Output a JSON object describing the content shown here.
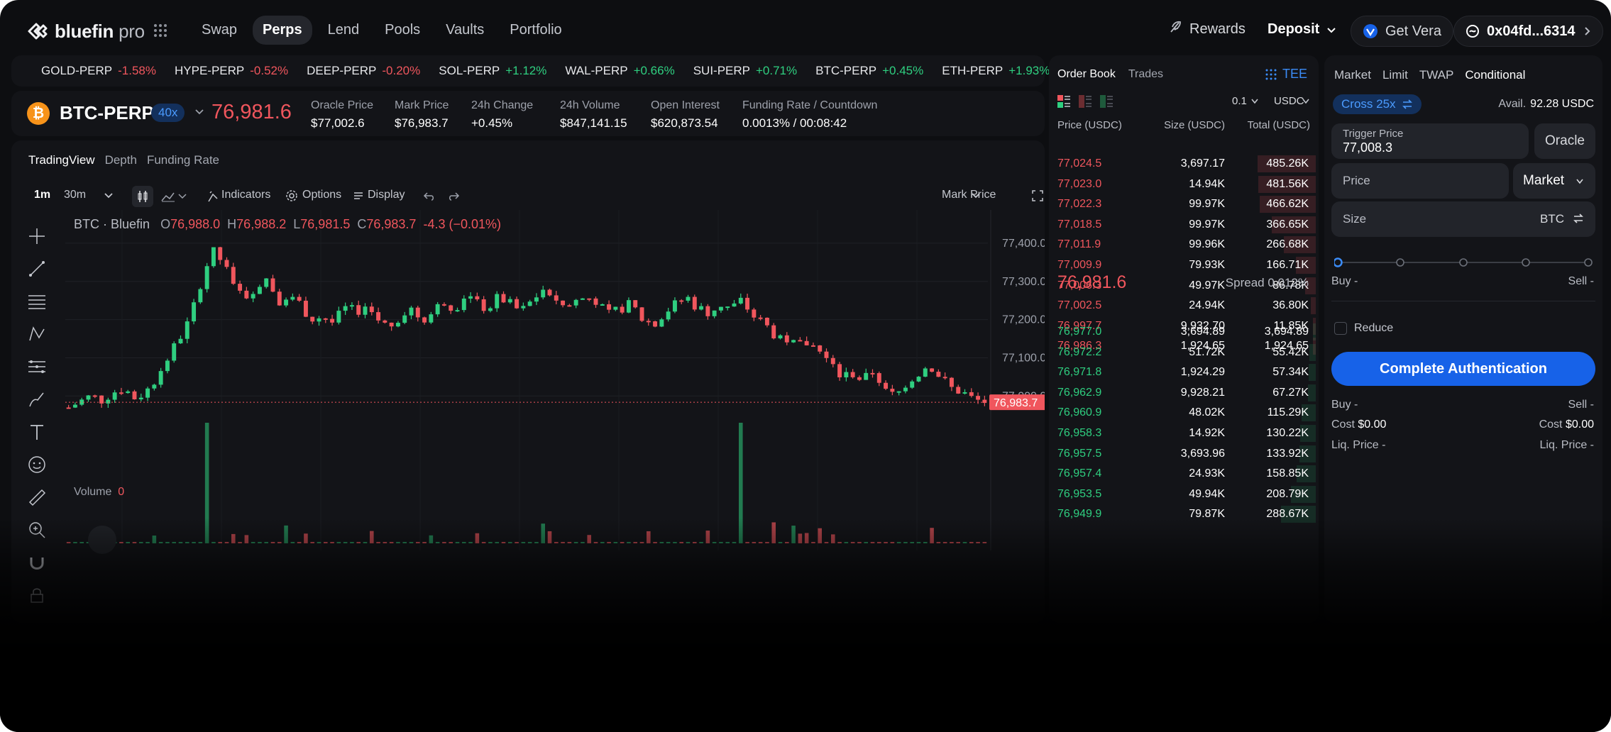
{
  "brand": {
    "name": "bluefin",
    "suffix": "pro"
  },
  "nav": {
    "items": [
      {
        "label": "Swap",
        "active": false
      },
      {
        "label": "Perps",
        "active": true
      },
      {
        "label": "Lend",
        "active": false
      },
      {
        "label": "Pools",
        "active": false
      },
      {
        "label": "Vaults",
        "active": false
      },
      {
        "label": "Portfolio",
        "active": false
      }
    ]
  },
  "header": {
    "rewards": "Rewards",
    "deposit": "Deposit",
    "get_vera": "Get Vera",
    "wallet": "0x04fd...6314"
  },
  "ticker": [
    {
      "symbol": "GOLD-PERP",
      "change": "-1.58%",
      "dir": "down"
    },
    {
      "symbol": "HYPE-PERP",
      "change": "-0.52%",
      "dir": "down"
    },
    {
      "symbol": "DEEP-PERP",
      "change": "-0.20%",
      "dir": "down"
    },
    {
      "symbol": "SOL-PERP",
      "change": "+1.12%",
      "dir": "up"
    },
    {
      "symbol": "WAL-PERP",
      "change": "+0.66%",
      "dir": "up"
    },
    {
      "symbol": "SUI-PERP",
      "change": "+0.71%",
      "dir": "up"
    },
    {
      "symbol": "BTC-PERP",
      "change": "+0.45%",
      "dir": "up"
    },
    {
      "symbol": "ETH-PERP",
      "change": "+1.93%",
      "dir": "up"
    }
  ],
  "market": {
    "coin_glyph": "₿",
    "pair": "BTC-PERP",
    "leverage": "40x",
    "price": "76,981.6",
    "oracle_label": "Oracle Price",
    "oracle": "$77,002.6",
    "mark_label": "Mark Price",
    "mark": "$76,983.7",
    "change_label": "24h Change",
    "change": "+0.45%",
    "volume_label": "24h Volume",
    "volume": "$847,141.15",
    "oi_label": "Open Interest",
    "oi": "$620,873.54",
    "funding_label": "Funding Rate / Countdown",
    "funding": "0.0013%",
    "countdown": "/ 00:08:42"
  },
  "chart_tabs": [
    "TradingView",
    "Depth",
    "Funding Rate"
  ],
  "chart_toolbar": {
    "interval1": "1m",
    "interval2": "30m",
    "indicators": "Indicators",
    "options": "Options",
    "display": "Display",
    "price_type": "Mark Price"
  },
  "chart_legend": {
    "title": "BTC · Bluefin",
    "o_label": "O",
    "o": "76,988.0",
    "h_label": "H",
    "h": "76,988.2",
    "l_label": "L",
    "l": "76,981.5",
    "c_label": "C",
    "c": "76,983.7",
    "chg": "-4.3 (−0.01%)",
    "volume_label": "Volume",
    "volume": "0",
    "last_price_tag": "76,983.7"
  },
  "chart_data": {
    "type": "candlestick",
    "title": "BTC · Bluefin",
    "y_ticks": [
      "77,400.0",
      "77,300.0",
      "77,200.0",
      "77,100.0",
      "77,000.0"
    ],
    "ylim": [
      76930,
      77450
    ],
    "close_path": [
      76970,
      76985,
      77000,
      76990,
      77010,
      77020,
      76995,
      77010,
      77050,
      77100,
      77150,
      77200,
      77300,
      77380,
      77350,
      77280,
      77260,
      77290,
      77310,
      77250,
      77270,
      77240,
      77200,
      77210,
      77190,
      77230,
      77220,
      77240,
      77200,
      77180,
      77210,
      77230,
      77200,
      77220,
      77250,
      77230,
      77270,
      77240,
      77230,
      77260,
      77240,
      77220,
      77250,
      77280,
      77260,
      77230,
      77250,
      77260,
      77240,
      77210,
      77230,
      77240,
      77200,
      77190,
      77220,
      77240,
      77260,
      77230,
      77220,
      77240,
      77230,
      77250,
      77210,
      77190,
      77160,
      77150,
      77130,
      77140,
      77120,
      77080,
      77050,
      77060,
      77040,
      77070,
      77010,
      77000,
      77040,
      77060,
      77080,
      77050,
      77020,
      77010,
      76990,
      76985
    ],
    "last": 76983.7
  },
  "orderbook": {
    "tab_orderbook": "Order Book",
    "tab_trades": "Trades",
    "tee": "TEE",
    "tick": "0.1",
    "unit": "USDC",
    "col_price": "Price (USDC)",
    "col_size": "Size (USDC)",
    "col_total": "Total (USDC)",
    "asks": [
      {
        "price": "77,024.5",
        "size": "3,697.17",
        "total": "485.26K",
        "depth": 1.0
      },
      {
        "price": "77,023.0",
        "size": "14.94K",
        "total": "481.56K",
        "depth": 0.99
      },
      {
        "price": "77,022.3",
        "size": "99.97K",
        "total": "466.62K",
        "depth": 0.96
      },
      {
        "price": "77,018.5",
        "size": "99.97K",
        "total": "366.65K",
        "depth": 0.76
      },
      {
        "price": "77,011.9",
        "size": "99.96K",
        "total": "266.68K",
        "depth": 0.55
      },
      {
        "price": "77,009.9",
        "size": "79.93K",
        "total": "166.71K",
        "depth": 0.34
      },
      {
        "price": "77,006.3",
        "size": "49.97K",
        "total": "86.78K",
        "depth": 0.18
      },
      {
        "price": "77,002.5",
        "size": "24.94K",
        "total": "36.80K",
        "depth": 0.08
      },
      {
        "price": "76,997.7",
        "size": "9,932.70",
        "total": "11.85K",
        "depth": 0.03
      },
      {
        "price": "76,986.3",
        "size": "1,924.65",
        "total": "1,924.65",
        "depth": 0.01
      }
    ],
    "mid": "76,981.6",
    "spread": "Spread 0.012%",
    "bids": [
      {
        "price": "76,977.0",
        "size": "3,694.89",
        "total": "3,694.89",
        "depth": 0.01
      },
      {
        "price": "76,972.2",
        "size": "51.72K",
        "total": "55.42K",
        "depth": 0.11
      },
      {
        "price": "76,971.8",
        "size": "1,924.29",
        "total": "57.34K",
        "depth": 0.12
      },
      {
        "price": "76,962.9",
        "size": "9,928.21",
        "total": "67.27K",
        "depth": 0.14
      },
      {
        "price": "76,960.9",
        "size": "48.02K",
        "total": "115.29K",
        "depth": 0.24
      },
      {
        "price": "76,958.3",
        "size": "14.92K",
        "total": "130.22K",
        "depth": 0.27
      },
      {
        "price": "76,957.5",
        "size": "3,693.96",
        "total": "133.92K",
        "depth": 0.28
      },
      {
        "price": "76,957.4",
        "size": "24.93K",
        "total": "158.85K",
        "depth": 0.33
      },
      {
        "price": "76,953.5",
        "size": "49.94K",
        "total": "208.79K",
        "depth": 0.43
      },
      {
        "price": "76,949.9",
        "size": "79.87K",
        "total": "288.67K",
        "depth": 0.6
      }
    ]
  },
  "trade": {
    "tabs": [
      {
        "label": "Market",
        "active": false
      },
      {
        "label": "Limit",
        "active": false
      },
      {
        "label": "TWAP",
        "active": false
      },
      {
        "label": "Conditional",
        "active": true
      }
    ],
    "margin_mode": "Cross 25x",
    "avail_label": "Avail.",
    "avail": "92.28 USDC",
    "trigger_label": "Trigger Price",
    "trigger_value": "77,008.3",
    "oracle_button": "Oracle",
    "price_placeholder": "Price",
    "order_type": "Market",
    "size_placeholder": "Size",
    "size_unit": "BTC",
    "buy_label": "Buy -",
    "sell_label": "Sell -",
    "reduce_label": "Reduce",
    "auth_button": "Complete Authentication",
    "buy2": "Buy -",
    "sell2": "Sell -",
    "cost_label": "Cost",
    "cost_buy": "$0.00",
    "cost_sell": "$0.00",
    "liq_buy": "Liq. Price -",
    "liq_sell": "Liq. Price -"
  }
}
